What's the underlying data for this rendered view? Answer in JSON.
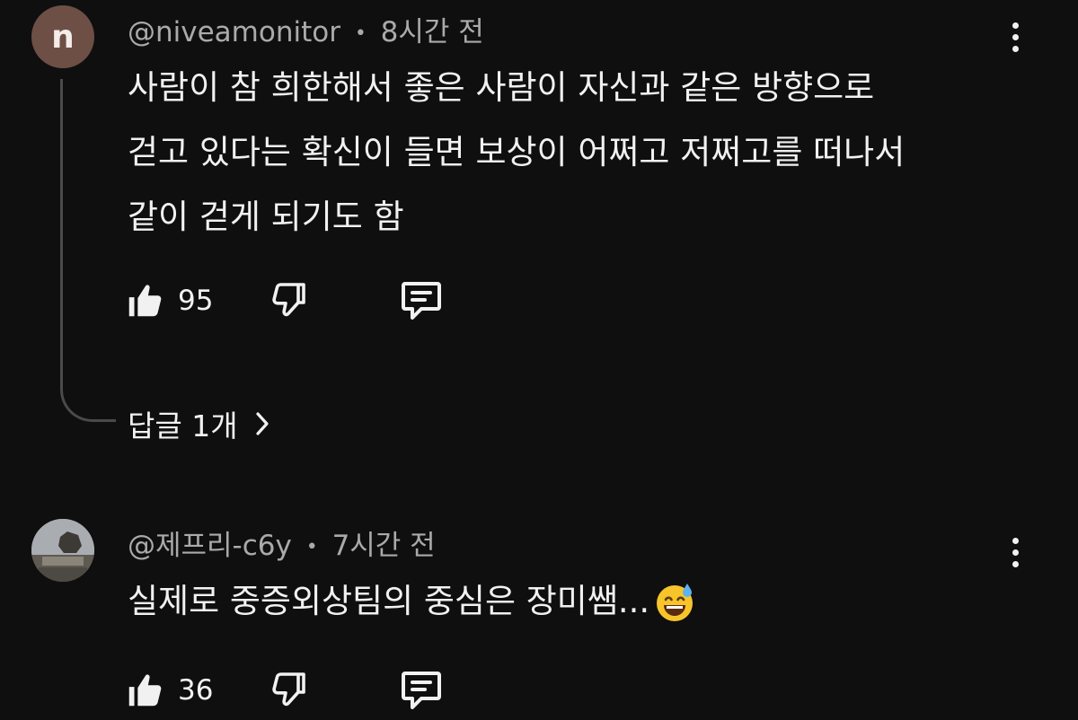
{
  "comments": [
    {
      "avatar_letter": "n",
      "author": "@niveamonitor",
      "time": "8시간 전",
      "lines": [
        "사람이 참 희한해서 좋은 사람이 자신과 같은 방향으로",
        "걷고 있다는 확신이 들면 보상이 어쩌고 저쩌고를 떠나서",
        "같이 걷게 되기도 함"
      ],
      "likes": "95",
      "replies_label": "답글 1개"
    },
    {
      "author": "@제프리-c6y",
      "time": "7시간 전",
      "lines": [
        "실제로 중증외상팀의 중심은 장미쌤..."
      ],
      "likes": "36"
    }
  ],
  "separator": "•",
  "colors": {
    "background": "#0f0f0f",
    "text": "#f1f1f1",
    "meta": "#aaaaaa",
    "avatar_bg": "#6d4f46",
    "thread_line": "#4a4a4a"
  },
  "icons": [
    "thumb-up-icon",
    "thumb-down-icon",
    "comment-reply-icon",
    "more-vert-icon",
    "chevron-right-icon",
    "grinning-sweat-emoji-icon"
  ]
}
